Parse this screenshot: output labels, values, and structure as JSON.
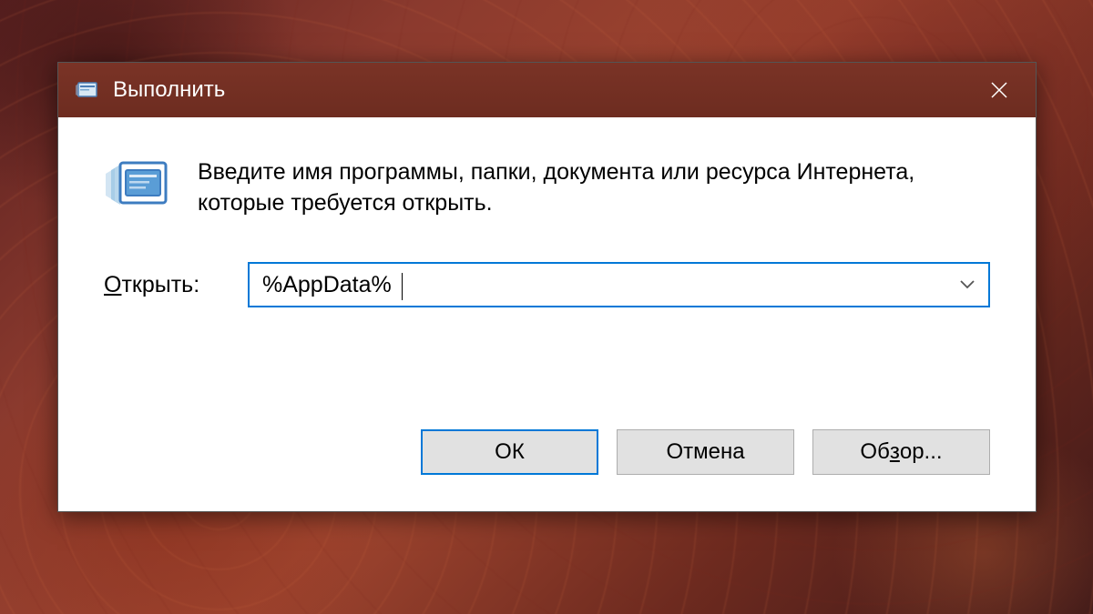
{
  "dialog": {
    "title": "Выполнить",
    "description": "Введите имя программы, папки, документа или ресурса Интернета, которые требуется открыть.",
    "open_label": "Открыть:",
    "input_value": "%AppData%",
    "buttons": {
      "ok": "ОК",
      "cancel": "Отмена",
      "browse_prefix": "Об",
      "browse_underline": "з",
      "browse_suffix": "ор..."
    }
  }
}
